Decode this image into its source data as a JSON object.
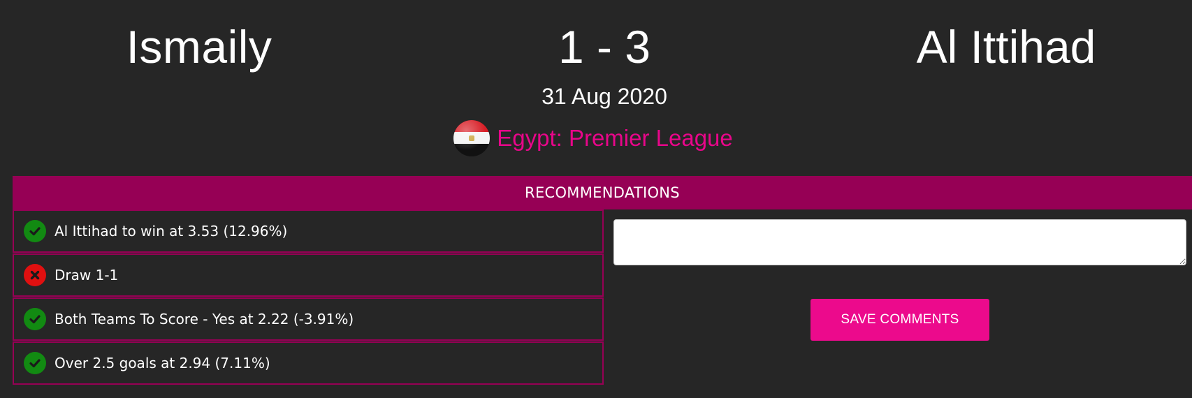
{
  "match": {
    "home_team": "Ismaily",
    "score": "1 - 3",
    "away_team": "Al Ittihad",
    "date": "31 Aug 2020",
    "league": "Egypt: Premier League",
    "flag_icon": "egypt-flag-icon"
  },
  "recommendations": {
    "header": "RECOMMENDATIONS",
    "items": [
      {
        "status": "correct",
        "icon": "check-circle-icon",
        "text": "Al Ittihad to win at 3.53 (12.96%)"
      },
      {
        "status": "incorrect",
        "icon": "x-circle-icon",
        "text": "Draw 1-1"
      },
      {
        "status": "correct",
        "icon": "check-circle-icon",
        "text": "Both Teams To Score - Yes at 2.22 (-3.91%)"
      },
      {
        "status": "correct",
        "icon": "check-circle-icon",
        "text": "Over 2.5 goals at 2.94 (7.11%)"
      }
    ]
  },
  "comments": {
    "value": "",
    "placeholder": "",
    "save_label": "SAVE COMMENTS"
  },
  "colors": {
    "background": "#262626",
    "accent_pink": "#e8068a",
    "header_magenta": "#960055",
    "button_pink": "#ec0a8c",
    "success_green": "#128a12",
    "fail_red": "#e01010"
  }
}
